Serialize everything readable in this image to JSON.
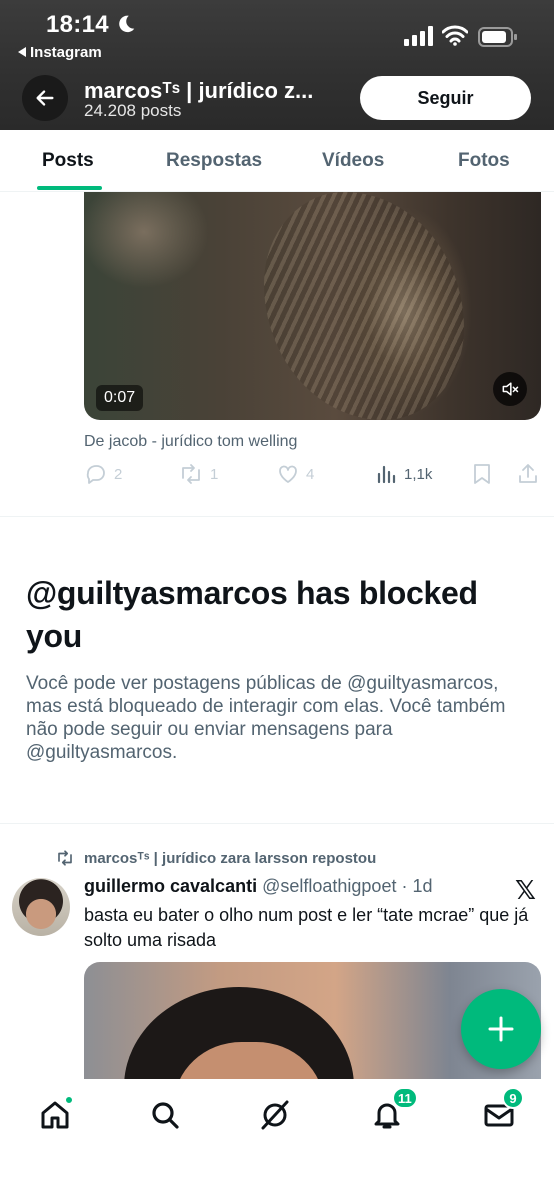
{
  "status_bar": {
    "time": "18:14",
    "back_app": "Instagram"
  },
  "header": {
    "name": "marcosᵀˢ | jurídico z...",
    "posts_count": "24.208 posts",
    "follow_label": "Seguir"
  },
  "tabs": [
    {
      "label": "Posts",
      "active": true
    },
    {
      "label": "Respostas",
      "active": false
    },
    {
      "label": "Vídeos",
      "active": false
    },
    {
      "label": "Fotos",
      "active": false
    }
  ],
  "video_post": {
    "duration": "0:07",
    "credit": "De jacob - jurídico tom welling",
    "replies": "2",
    "reposts": "1",
    "likes": "4",
    "views": "1,1k"
  },
  "blocked": {
    "title": "@guiltyasmarcos has blocked you",
    "description": "Você pode ver postagens públicas de @guiltyasmarcos, mas está bloqueado de interagir com elas. Você também não pode seguir ou enviar mensagens para @guiltyasmarcos."
  },
  "repost": {
    "reposted_by": "marcosᵀˢ | jurídico zara larsson repostou",
    "author": "guillermo cavalcanti",
    "handle": "@selfloathigpoet",
    "time": "· 1d",
    "text": "basta eu bater o olho num post e ler “tate mcrae” que já solto uma risada"
  },
  "bottom_nav": {
    "notifications_badge": "11",
    "messages_badge": "9"
  },
  "colors": {
    "accent": "#00ba7c",
    "text_primary": "#0f1419",
    "text_secondary": "#536471"
  }
}
